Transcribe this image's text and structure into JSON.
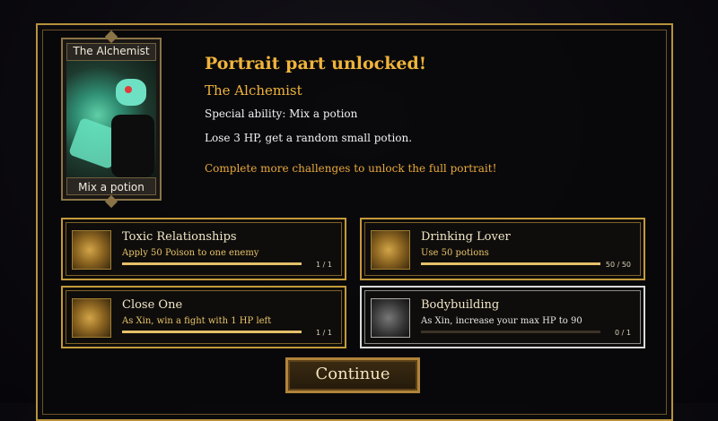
{
  "portrait_card": {
    "title": "The Alchemist",
    "footer": "Mix a potion"
  },
  "header": {
    "title": "Portrait part unlocked!",
    "subtitle": "The Alchemist",
    "ability": "Special ability: Mix a potion",
    "description": "Lose 3 HP, get a random small potion.",
    "more": "Complete more challenges to unlock the full portrait!"
  },
  "challenges": [
    {
      "name": "Toxic Relationships",
      "requirement": "Apply 50 Poison to one enemy",
      "count": "1 / 1",
      "progress": 1.0,
      "locked": false
    },
    {
      "name": "Drinking Lover",
      "requirement": "Use 50 potions",
      "count": "50 / 50",
      "progress": 1.0,
      "locked": false
    },
    {
      "name": "Close One",
      "requirement": "As Xin, win a fight with 1 HP left",
      "count": "1 / 1",
      "progress": 1.0,
      "locked": false
    },
    {
      "name": "Bodybuilding",
      "requirement": "As Xin, increase your max HP to 90",
      "count": "0 / 1",
      "progress": 0.0,
      "locked": true
    }
  ],
  "continue_label": "Continue",
  "colors": {
    "gold": "#f0b43a",
    "border": "#c49a3a",
    "locked_border": "#d9d9d9"
  }
}
